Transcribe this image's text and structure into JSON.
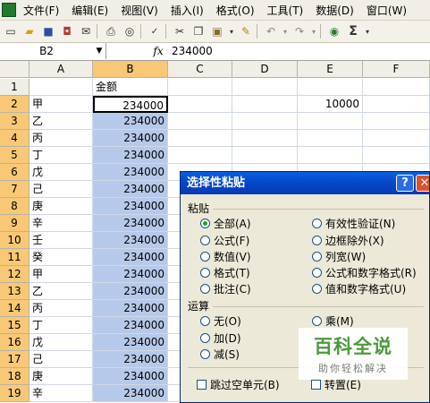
{
  "menu": [
    "文件(F)",
    "编辑(E)",
    "视图(V)",
    "插入(I)",
    "格式(O)",
    "工具(T)",
    "数据(D)",
    "窗口(W)"
  ],
  "toolbar": {
    "icons": [
      "new-icon",
      "open-icon",
      "save-icon",
      "permission-icon",
      "email-icon",
      "print-icon",
      "print-preview-icon",
      "spelling-icon",
      "cut-icon",
      "copy-icon",
      "paste-icon",
      "format-painter-icon",
      "undo-icon",
      "redo-icon",
      "hyperlink-icon",
      "autosum-icon"
    ],
    "sum_label": "Σ"
  },
  "formula_bar": {
    "name_box": "B2",
    "fx": "fx",
    "value": "234000"
  },
  "columns": [
    "A",
    "B",
    "C",
    "D",
    "E",
    "F"
  ],
  "rows": [
    {
      "n": "1",
      "a": "",
      "b": "金额",
      "e": ""
    },
    {
      "n": "2",
      "a": "甲",
      "b": "234000",
      "e": "10000"
    },
    {
      "n": "3",
      "a": "乙",
      "b": "234000",
      "e": ""
    },
    {
      "n": "4",
      "a": "丙",
      "b": "234000",
      "e": ""
    },
    {
      "n": "5",
      "a": "丁",
      "b": "234000",
      "e": ""
    },
    {
      "n": "6",
      "a": "戊",
      "b": "234000",
      "e": ""
    },
    {
      "n": "7",
      "a": "己",
      "b": "234000",
      "e": ""
    },
    {
      "n": "8",
      "a": "庚",
      "b": "234000",
      "e": ""
    },
    {
      "n": "9",
      "a": "辛",
      "b": "234000",
      "e": ""
    },
    {
      "n": "10",
      "a": "壬",
      "b": "234000",
      "e": ""
    },
    {
      "n": "11",
      "a": "癸",
      "b": "234000",
      "e": ""
    },
    {
      "n": "12",
      "a": "甲",
      "b": "234000",
      "e": ""
    },
    {
      "n": "13",
      "a": "乙",
      "b": "234000",
      "e": ""
    },
    {
      "n": "14",
      "a": "丙",
      "b": "234000",
      "e": ""
    },
    {
      "n": "15",
      "a": "丁",
      "b": "234000",
      "e": ""
    },
    {
      "n": "16",
      "a": "戊",
      "b": "234000",
      "e": ""
    },
    {
      "n": "17",
      "a": "己",
      "b": "234000",
      "e": ""
    },
    {
      "n": "18",
      "a": "庚",
      "b": "234000",
      "e": ""
    },
    {
      "n": "19",
      "a": "辛",
      "b": "234000",
      "e": ""
    }
  ],
  "dialog": {
    "title": "选择性粘贴",
    "help": "?",
    "close": "✕",
    "paste_group": "粘贴",
    "paste_options": [
      {
        "label": "全部(A)",
        "checked": true
      },
      {
        "label": "公式(F)",
        "checked": false
      },
      {
        "label": "数值(V)",
        "checked": false
      },
      {
        "label": "格式(T)",
        "checked": false
      },
      {
        "label": "批注(C)",
        "checked": false
      },
      {
        "label": "有效性验证(N)",
        "checked": false
      },
      {
        "label": "边框除外(X)",
        "checked": false
      },
      {
        "label": "列宽(W)",
        "checked": false
      },
      {
        "label": "公式和数字格式(R)",
        "checked": false
      },
      {
        "label": "值和数字格式(U)",
        "checked": false
      }
    ],
    "operation_group": "运算",
    "operation_options": [
      {
        "label": "无(O)",
        "checked": false
      },
      {
        "label": "加(D)",
        "checked": false
      },
      {
        "label": "减(S)",
        "checked": false
      },
      {
        "label": "乘(M)",
        "checked": false
      }
    ],
    "skip_blanks": "跳过空单元(B)",
    "transpose": "转置(E)"
  },
  "watermark": {
    "main": "百科全说",
    "sub": "助你轻松解决"
  },
  "colors": {
    "title_bar": "#0a5ee0",
    "selection": "#b7c9ea",
    "active_header": "#f8c877",
    "watermark": "#4b9a3d"
  }
}
